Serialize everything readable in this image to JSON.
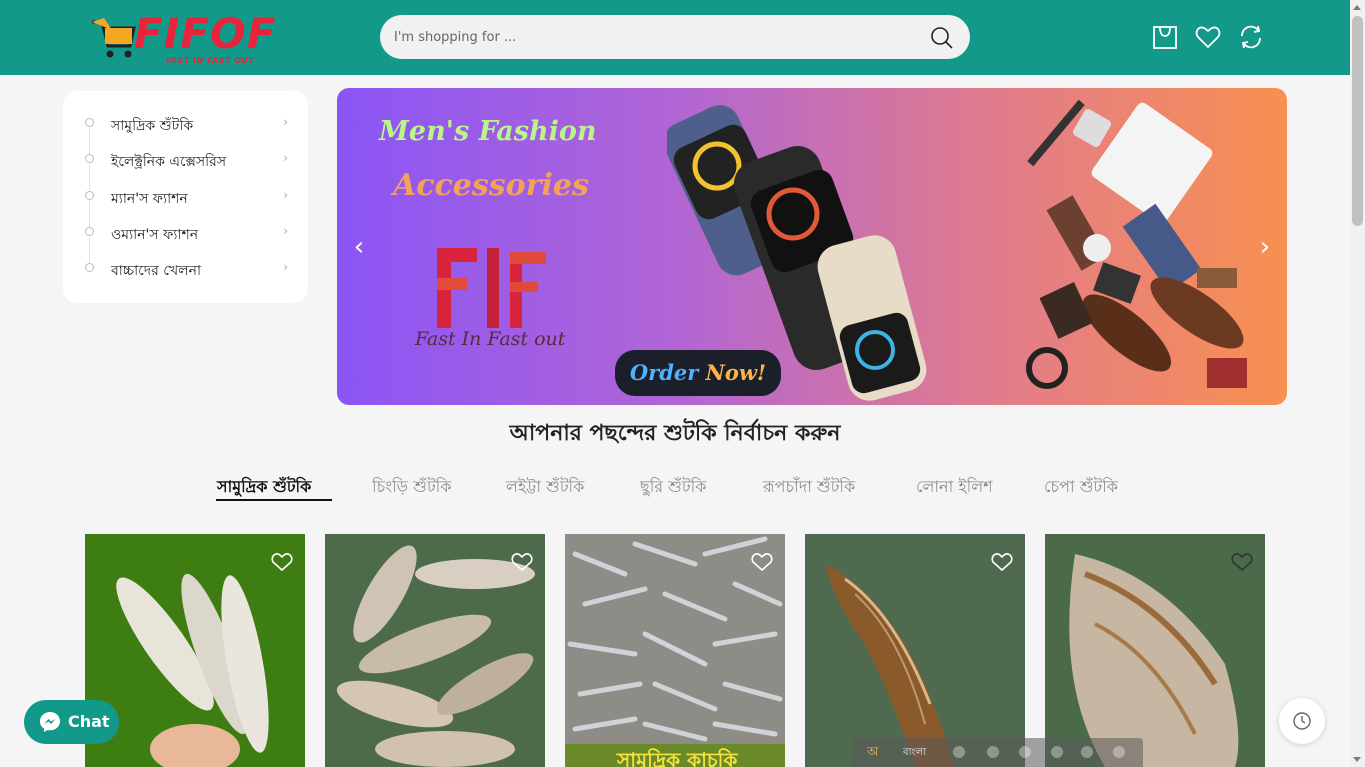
{
  "header": {
    "logo_text": "FIFOF",
    "logo_tagline": "FAST IN FAST OUT",
    "search_placeholder": "I'm shopping for ...",
    "icons": [
      "cart-icon",
      "heart-icon",
      "compare-icon"
    ]
  },
  "sidebar": {
    "items": [
      {
        "label": "সামুদ্রিক শুঁটকি"
      },
      {
        "label": "ইলেক্ট্রনিক এক্সেসরিস"
      },
      {
        "label": "ম্যান'স ফ্যাশন"
      },
      {
        "label": "ওম্যান'স ফ্যাশন"
      },
      {
        "label": "বাচ্চাদের খেলনা"
      }
    ]
  },
  "banner": {
    "title_line1": "Men's Fashion",
    "title_line2": "Accessories",
    "brand_tag": "Fast In Fast out",
    "order_label_1": "Order",
    "order_label_2": "Now!"
  },
  "section": {
    "title": "আপনার পছন্দের শুটকি নির্বাচন করুন",
    "tabs": [
      {
        "label": "সামুদ্রিক শুঁটকি",
        "active": true
      },
      {
        "label": "চিংড়ি শুঁটকি",
        "active": false
      },
      {
        "label": "লইট্টা শুঁটকি",
        "active": false
      },
      {
        "label": "ছুরি শুঁটকি",
        "active": false
      },
      {
        "label": "রূপচাঁদা শুঁটকি",
        "active": false
      },
      {
        "label": "লোনা ইলিশ",
        "active": false
      },
      {
        "label": "চেপা শুঁটকি",
        "active": false
      }
    ]
  },
  "products": [
    {
      "bg": "#3d7d12"
    },
    {
      "bg": "#4d6a4b"
    },
    {
      "bg": "#9a9a95"
    },
    {
      "bg": "#4f6a4f"
    },
    {
      "bg": "#4a6a4a"
    }
  ],
  "product_caption": "সামুদ্রিক কাচকি",
  "chat": {
    "label": "Chat"
  },
  "ime": {
    "indicator": "অ",
    "language": "বাংলা"
  },
  "colors": {
    "brand": "#12998a",
    "logo_red": "#e8243c"
  }
}
